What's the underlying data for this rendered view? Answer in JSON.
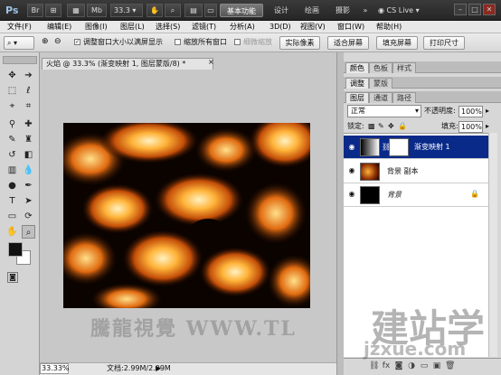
{
  "appbar": {
    "logo": "Ps",
    "zoom": "33.3",
    "workspaces": [
      "基本功能",
      "设计",
      "绘画",
      "摄影"
    ],
    "more": "»",
    "cslive": "CS Live"
  },
  "menu": [
    "文件(F)",
    "编辑(E)",
    "图像(I)",
    "图层(L)",
    "选择(S)",
    "滤镜(T)",
    "分析(A)",
    "3D(D)",
    "视图(V)",
    "窗口(W)",
    "帮助(H)"
  ],
  "options": {
    "resize": "调整窗口大小以满屏显示",
    "zoom_all": "缩放所有窗口",
    "scrubby": "细微缩放",
    "actual": "实际像素",
    "fit": "适合屏幕",
    "fill": "填充屏幕",
    "print": "打印尺寸"
  },
  "document": {
    "tab": "火焰 @ 33.3% (渐变映射 1, 图层蒙版/8) *",
    "zoom": "33.33%",
    "info": "文档:2.99M/2.99M"
  },
  "panels": {
    "row1": [
      "颜色",
      "色板",
      "样式"
    ],
    "row2": [
      "调整",
      "蒙版"
    ],
    "row3": [
      "图层",
      "通道",
      "路径"
    ],
    "blend": "正常",
    "opacity_label": "不透明度:",
    "opacity": "100%",
    "lock_label": "锁定:",
    "fill_label": "填充:",
    "fill": "100%",
    "layers": [
      {
        "name": "渐变映射 1",
        "selected": true
      },
      {
        "name": "背景 副本",
        "selected": false
      },
      {
        "name": "背景",
        "selected": false
      }
    ]
  },
  "watermark": {
    "line1": "騰龍視覺 WWW.TL",
    "line2": "建站学",
    "line3": "jzxue.com"
  }
}
